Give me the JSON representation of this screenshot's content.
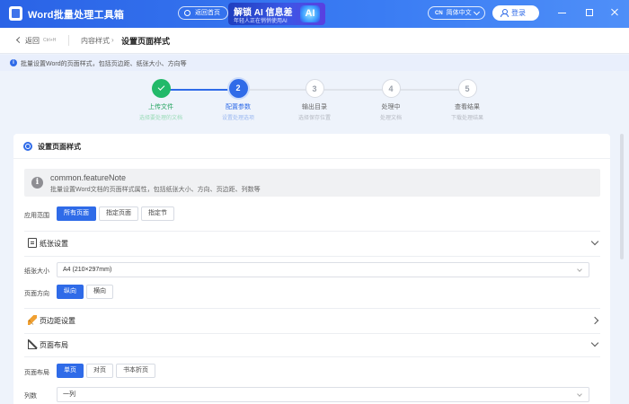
{
  "app": {
    "title": "Word批量处理工具箱",
    "back_home": "返回首页",
    "ad": {
      "main": "解锁 AI 信息差",
      "sub": "年轻人正在悄悄使用AI",
      "badge": "AI"
    },
    "language": {
      "code": "CN",
      "label": "简体中文"
    },
    "login": "登录"
  },
  "breadcrumb": {
    "back": "返回",
    "shortcut": "Ctrl+H",
    "parent": "内容样式",
    "separator": "›",
    "current": "设置页面样式"
  },
  "info": {
    "icon": "i",
    "text": "批量设置Word的页面样式，包括页边距、纸张大小、方向等"
  },
  "steps": [
    {
      "name": "上传文件",
      "desc": "选择要处理的文档",
      "status": "done"
    },
    {
      "name": "配置参数",
      "desc": "设置处理选项",
      "status": "active",
      "number": "2"
    },
    {
      "name": "输出目录",
      "desc": "选择保存位置",
      "status": "todo",
      "number": "3"
    },
    {
      "name": "处理中",
      "desc": "处理文档",
      "status": "todo",
      "number": "4"
    },
    {
      "name": "查看结果",
      "desc": "下载处理结果",
      "status": "todo",
      "number": "5"
    }
  ],
  "card": {
    "title": "设置页面样式",
    "note": {
      "icon": "i",
      "title": "common.featureNote",
      "desc": "批量设置Word文档的页面样式属性，包括纸张大小、方向、页边距、列数等"
    },
    "scope": {
      "label": "应用范围",
      "options": [
        "所有页面",
        "指定页面",
        "指定节"
      ],
      "selected": 0
    },
    "paper_section": {
      "title": "纸张设置",
      "expanded": true
    },
    "paper_size": {
      "label": "纸张大小",
      "value": "A4 (210×297mm)"
    },
    "orientation": {
      "label": "页面方向",
      "options": [
        "纵向",
        "横向"
      ],
      "selected": 0
    },
    "margin_section": {
      "title": "页边距设置",
      "expanded": false
    },
    "layout_section": {
      "title": "页面布局",
      "expanded": true
    },
    "layout": {
      "label": "页面布局",
      "options": [
        "单页",
        "对页",
        "书本折页"
      ],
      "selected": 0
    },
    "columns": {
      "label": "列数",
      "value": "一列"
    }
  },
  "colors": {
    "primary": "#2f6be8",
    "success": "#22b969",
    "titlebar": "#3a7cf3"
  }
}
